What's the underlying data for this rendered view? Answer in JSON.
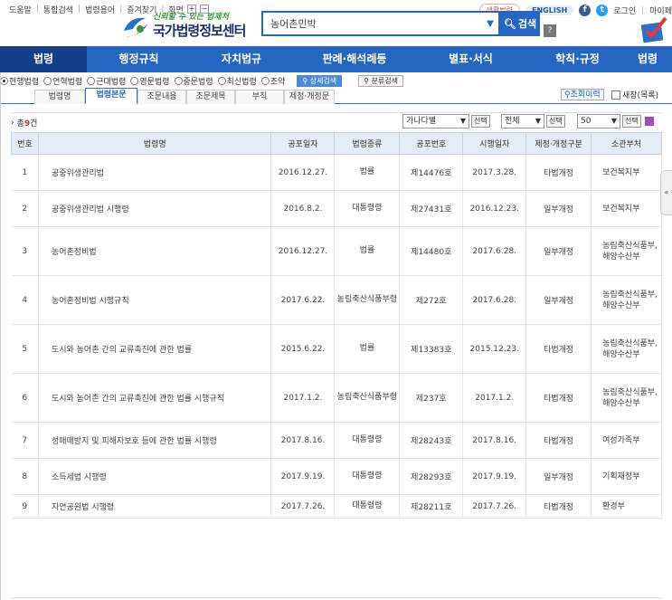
{
  "util_links": [
    "도움말",
    "통합검색",
    "법령용어",
    "즐겨찾기",
    "화면"
  ],
  "util_right": {
    "badge": "생활법령",
    "english": "ENGLISH",
    "facebook": "f",
    "twitter": "t",
    "login": "로그인",
    "mypage": "마이페"
  },
  "logo": {
    "slogan": "신뢰할 수 있는 법제처",
    "title": "국가법령정보센터"
  },
  "search": {
    "value": "농어촌민박",
    "button": "검색",
    "help": "?"
  },
  "main_nav": [
    "법령",
    "행정규칙",
    "자치법규",
    "판례·해석례등",
    "별표·서식",
    "학칙·규정",
    "법령"
  ],
  "filters": {
    "radios": [
      {
        "label": "현행법령",
        "checked": true
      },
      {
        "label": "연혁법령",
        "checked": false
      },
      {
        "label": "근대법령",
        "checked": false
      },
      {
        "label": "영문법령",
        "checked": false
      },
      {
        "label": "중문법령",
        "checked": false
      },
      {
        "label": "최신법령",
        "checked": false
      },
      {
        "label": "조약",
        "checked": false
      }
    ],
    "advanced": "상세검색",
    "classify": "분류검색"
  },
  "sub_tabs": [
    "법령명",
    "법령본문",
    "조문내용",
    "조문제목",
    "부칙",
    "제정·개정문"
  ],
  "history_button": "조회이력",
  "history_check": "새창(목록)",
  "result": {
    "prefix": "총",
    "count": "9",
    "suffix": "건",
    "sort": "가나다별",
    "scope": "전체",
    "per_page": "50",
    "select_label": "선택"
  },
  "table": {
    "headers": [
      "번호",
      "법령명",
      "공포일자",
      "법령종류",
      "공포번호",
      "시행일자",
      "제정·개정구분",
      "소관부처"
    ],
    "rows": [
      {
        "no": "1",
        "name": "공중위생관리법",
        "pub_date": "2016.12.27.",
        "kind": "법률",
        "pub_no": "제14476호",
        "eff_date": "2017.3.28.",
        "amend": "타법개정",
        "dept": "보건복지부"
      },
      {
        "no": "2",
        "name": "공중위생관리법 시행령",
        "pub_date": "2016.8.2.",
        "kind": "대통령령",
        "pub_no": "제27431호",
        "eff_date": "2016.12.23.",
        "amend": "일부개정",
        "dept": "보건복지부"
      },
      {
        "no": "3",
        "name": "농어촌정비법",
        "pub_date": "2016.12.27.",
        "kind": "법률",
        "pub_no": "제14480호",
        "eff_date": "2017.6.28.",
        "amend": "일부개정",
        "dept": "농림축산식품부,해양수산부"
      },
      {
        "no": "4",
        "name": "농어촌정비법 시행규칙",
        "pub_date": "2017.6.22.",
        "kind": "농림축산식품부령",
        "pub_no": "제272호",
        "eff_date": "2017.6.28.",
        "amend": "일부개정",
        "dept": "농림축산식품부,해양수산부"
      },
      {
        "no": "5",
        "name": "도시와 농어촌 간의 교류촉진에 관한 법률",
        "pub_date": "2015.6.22.",
        "kind": "법률",
        "pub_no": "제13383호",
        "eff_date": "2015.12.23.",
        "amend": "타법개정",
        "dept": "농림축산식품부,해양수산부"
      },
      {
        "no": "6",
        "name": "도시와 농어촌 간의 교류촉진에 관한 법률 시행규칙",
        "pub_date": "2017.1.2.",
        "kind": "농림축산식품부령",
        "pub_no": "제237호",
        "eff_date": "2017.1.2.",
        "amend": "타법개정",
        "dept": "농림축산식품부,해양수산부"
      },
      {
        "no": "7",
        "name": "성매매방지 및 피해자보호 등에 관한 법률 시행령",
        "pub_date": "2017.8.16.",
        "kind": "대통령령",
        "pub_no": "제28243호",
        "eff_date": "2017.8.16.",
        "amend": "타법개정",
        "dept": "여성가족부"
      },
      {
        "no": "8",
        "name": "소득세법 시행령",
        "pub_date": "2017.9.19.",
        "kind": "대통령령",
        "pub_no": "제28293호",
        "eff_date": "2017.9.19.",
        "amend": "일부개정",
        "dept": "기획재정부"
      },
      {
        "no": "9",
        "name": "자연공원법 시행령",
        "pub_date": "2017.7.26.",
        "kind": "대통령령",
        "pub_no": "제28211호",
        "eff_date": "2017.7.26.",
        "amend": "타법개정",
        "dept": "환경부"
      }
    ]
  },
  "side_handle": "«",
  "colors": {
    "nav_blue": "#2566c2",
    "nav_active": "#133f89",
    "count_red": "#d03030"
  }
}
